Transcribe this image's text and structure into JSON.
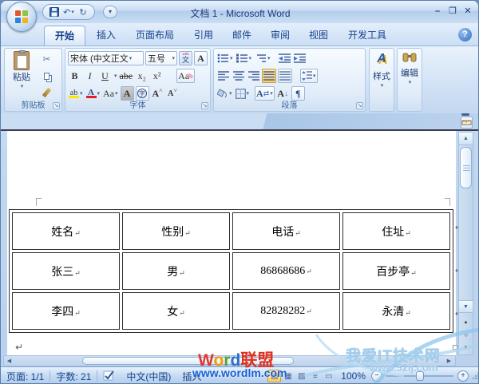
{
  "window": {
    "title": "文档 1 - Microsoft Word",
    "controls": {
      "minimize": "–",
      "maximize": "❐",
      "close": "✕"
    }
  },
  "icons": {
    "dropdown": "▾",
    "undo": "↶",
    "redo": "↻",
    "cut": "✂",
    "help": "?",
    "up": "▲",
    "down": "▼",
    "left": "◀",
    "right": "▶",
    "browse_prev": "▲",
    "browse_circle": "○",
    "browse_next": "▼",
    "pilcrow": "¶",
    "check": "✓",
    "sort_letter": "A",
    "sort_arrow": "↓",
    "swap_arrows": "⇄",
    "view_print": "▤",
    "view_read": "▦",
    "view_web": "▧",
    "view_outline": "≡",
    "view_draft": "▭",
    "zoom_out": "−",
    "zoom_in": "+",
    "phonetic_char": "文",
    "circled_char": "字",
    "grow_caret": "˄",
    "shrink_caret": "˅"
  },
  "tabs": [
    {
      "label": "开始",
      "active": true
    },
    {
      "label": "插入",
      "active": false
    },
    {
      "label": "页面布局",
      "active": false
    },
    {
      "label": "引用",
      "active": false
    },
    {
      "label": "邮件",
      "active": false
    },
    {
      "label": "审阅",
      "active": false
    },
    {
      "label": "视图",
      "active": false
    },
    {
      "label": "开发工具",
      "active": false
    }
  ],
  "ribbon": {
    "clipboard": {
      "group_label": "剪贴板",
      "paste_label": "粘贴"
    },
    "font": {
      "group_label": "字体",
      "font_name": "宋体 (中文正文",
      "font_size": "五号",
      "bold": "B",
      "italic": "I",
      "underline": "U",
      "strikethrough": "abe",
      "subscript": "x₂",
      "superscript": "x²",
      "clear_formatting": "Aa",
      "highlight": "ab",
      "font_color": "A",
      "change_case": "Aa",
      "char_border": "A",
      "char_shading": "A",
      "grow_font": "A",
      "shrink_font": "A"
    },
    "paragraph": {
      "group_label": "段落"
    },
    "styles": {
      "group_label": "样式",
      "icon_letter": "A"
    },
    "editing": {
      "group_label": "编辑"
    }
  },
  "document": {
    "table": {
      "headers": [
        "姓名",
        "性别",
        "电话",
        "住址"
      ],
      "rows": [
        [
          "张三",
          "男",
          "86868686",
          "百步亭"
        ],
        [
          "李四",
          "女",
          "82828282",
          "永清"
        ]
      ],
      "cell_mark": "↵"
    },
    "paragraph_mark": "↵"
  },
  "status_bar": {
    "page": "页面: 1/1",
    "word_count": "字数: 21",
    "language": "中文(中国)",
    "insert_mode": "插入",
    "zoom_level": "100%"
  },
  "watermarks": {
    "center_letters": [
      {
        "ch": "W"
      },
      {
        "ch": "o"
      },
      {
        "ch": "r"
      },
      {
        "ch": "d"
      }
    ],
    "center_suffix": "联盟",
    "center_url": "www.wordlm.com",
    "right_title": "我爱IT技术网",
    "right_url": "www.52ij.com"
  },
  "colors": {
    "title_text": "#1e3c78",
    "status_text": "#15428b",
    "active_tab_bg": "#fdfeff",
    "justify_active_bg": "#ffd578",
    "watermark_blue": "#1560d4",
    "watermark_red": "#e0301e",
    "watermark_light_blue": "#a5cfee",
    "highlight_yellow": "#ffe400",
    "font_color_red": "#e02020"
  }
}
